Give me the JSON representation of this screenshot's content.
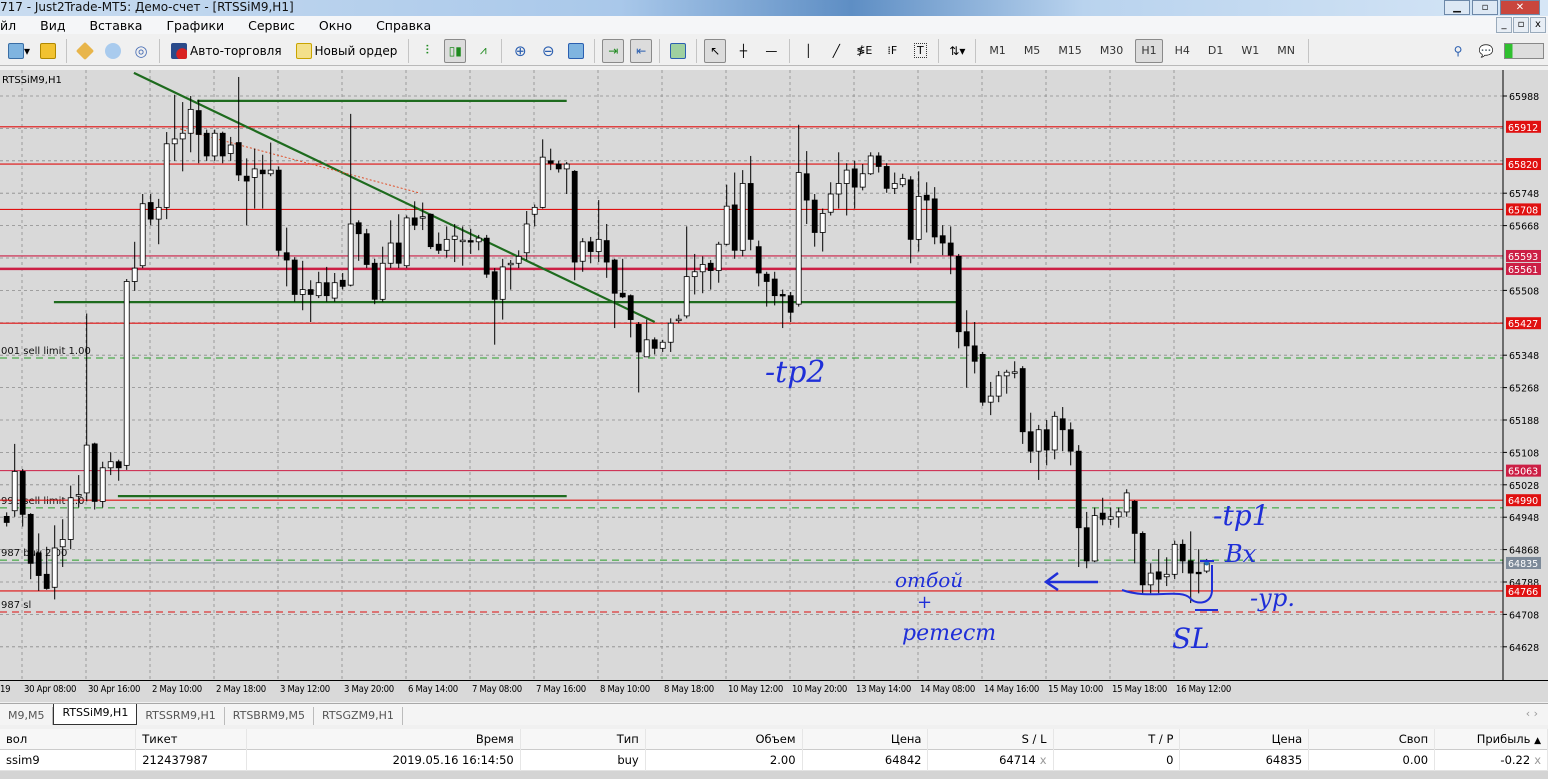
{
  "window": {
    "title": "717 - Just2Trade-MT5: Демо-счет - [RTSSiM9,H1]"
  },
  "menu": [
    "йл",
    "Вид",
    "Вставка",
    "Графики",
    "Сервис",
    "Окно",
    "Справка"
  ],
  "toolbar": {
    "auto_trading": "Авто-торговля",
    "new_order": "Новый ордер",
    "timeframes": [
      "M1",
      "M5",
      "M15",
      "M30",
      "H1",
      "H4",
      "D1",
      "W1",
      "MN"
    ],
    "active_timeframe": "H1"
  },
  "chart_data": {
    "type": "candlestick",
    "title": "RTSSiM9,H1",
    "ylim": [
      64560,
      66050
    ],
    "price_ticks": [
      "65988",
      "65748",
      "65668",
      "65508",
      "65348",
      "65268",
      "65188",
      "65108",
      "65028",
      "64948",
      "64868",
      "64788",
      "64708",
      "64628"
    ],
    "grid_prices": [
      65988,
      65908,
      65828,
      65748,
      65668,
      65588,
      65508,
      65428,
      65348,
      65268,
      65188,
      65108,
      65028,
      64948,
      64868,
      64788,
      64708,
      64628
    ],
    "time_labels": [
      "19",
      "30 Apr 08:00",
      "30 Apr 16:00",
      "2 May 10:00",
      "2 May 18:00",
      "3 May 12:00",
      "3 May 20:00",
      "6 May 14:00",
      "7 May 08:00",
      "7 May 16:00",
      "8 May 10:00",
      "8 May 18:00",
      "10 May 12:00",
      "10 May 20:00",
      "13 May 14:00",
      "14 May 08:00",
      "14 May 16:00",
      "15 May 10:00",
      "15 May 18:00",
      "16 May 12:00"
    ],
    "candles_ohlc": [
      [
        64950,
        64960,
        64925,
        64935
      ],
      [
        64964,
        65129,
        64949,
        65061
      ],
      [
        65061,
        65067,
        64925,
        64955
      ],
      [
        64955,
        64958,
        64795,
        64834
      ],
      [
        64860,
        64908,
        64766,
        64804
      ],
      [
        64807,
        64875,
        64769,
        64772
      ],
      [
        64775,
        64928,
        64745,
        64872
      ],
      [
        64875,
        64943,
        64825,
        64893
      ],
      [
        64893,
        65026,
        64869,
        64996
      ],
      [
        65000,
        65052,
        64972,
        65004
      ],
      [
        65008,
        65451,
        64987,
        65126
      ],
      [
        65129,
        65132,
        64967,
        64987
      ],
      [
        64987,
        65085,
        64972,
        65070
      ],
      [
        65070,
        65108,
        65052,
        65085
      ],
      [
        65085,
        65090,
        65038,
        65070
      ],
      [
        65076,
        65536,
        65065,
        65530
      ],
      [
        65530,
        65628,
        65507,
        65563
      ],
      [
        65569,
        65746,
        65563,
        65722
      ],
      [
        65725,
        65746,
        65669,
        65684
      ],
      [
        65684,
        65734,
        65622,
        65713
      ],
      [
        65713,
        65899,
        65684,
        65870
      ],
      [
        65870,
        65991,
        65828,
        65882
      ],
      [
        65882,
        65973,
        65802,
        65896
      ],
      [
        65896,
        65988,
        65849,
        65955
      ],
      [
        65952,
        65979,
        65822,
        65893
      ],
      [
        65896,
        65905,
        65828,
        65840
      ],
      [
        65840,
        65905,
        65828,
        65896
      ],
      [
        65896,
        65900,
        65822,
        65840
      ],
      [
        65846,
        65887,
        65828,
        65867
      ],
      [
        65873,
        66035,
        65778,
        65793
      ],
      [
        65790,
        65834,
        65669,
        65778
      ],
      [
        65787,
        65858,
        65710,
        65808
      ],
      [
        65805,
        65843,
        65710,
        65796
      ],
      [
        65796,
        65873,
        65790,
        65805
      ],
      [
        65805,
        65814,
        65592,
        65607
      ],
      [
        65601,
        65663,
        65518,
        65583
      ],
      [
        65583,
        65590,
        65480,
        65498
      ],
      [
        65498,
        65581,
        65459,
        65510
      ],
      [
        65510,
        65533,
        65430,
        65498
      ],
      [
        65495,
        65554,
        65489,
        65527
      ],
      [
        65527,
        65566,
        65480,
        65495
      ],
      [
        65489,
        65551,
        65480,
        65527
      ],
      [
        65533,
        65551,
        65510,
        65518
      ],
      [
        65521,
        65944,
        65518,
        65672
      ],
      [
        65675,
        65681,
        65581,
        65648
      ],
      [
        65648,
        65660,
        65563,
        65572
      ],
      [
        65575,
        65586,
        65474,
        65486
      ],
      [
        65486,
        65616,
        65480,
        65575
      ],
      [
        65575,
        65681,
        65563,
        65625
      ],
      [
        65625,
        65696,
        65563,
        65575
      ],
      [
        65569,
        65693,
        65563,
        65687
      ],
      [
        65687,
        65728,
        65657,
        65669
      ],
      [
        65688,
        65725,
        65657,
        65690
      ],
      [
        65696,
        65698,
        65610,
        65616
      ],
      [
        65622,
        65651,
        65598,
        65607
      ],
      [
        65607,
        65666,
        65589,
        65634
      ],
      [
        65634,
        65672,
        65578,
        65642
      ],
      [
        65630,
        65666,
        65569,
        65632
      ],
      [
        65631,
        65660,
        65598,
        65630
      ],
      [
        65628,
        65645,
        65607,
        65637
      ],
      [
        65637,
        65645,
        65539,
        65548
      ],
      [
        65554,
        65563,
        65374,
        65486
      ],
      [
        65486,
        65586,
        65436,
        65566
      ],
      [
        65572,
        65583,
        65510,
        65575
      ],
      [
        65575,
        65607,
        65563,
        65592
      ],
      [
        65601,
        65704,
        65583,
        65672
      ],
      [
        65696,
        65720,
        65666,
        65713
      ],
      [
        65713,
        65881,
        65710,
        65837
      ],
      [
        65828,
        65858,
        65805,
        65822
      ],
      [
        65820,
        65828,
        65799,
        65808
      ],
      [
        65808,
        65825,
        65746,
        65820
      ],
      [
        65802,
        65805,
        65533,
        65578
      ],
      [
        65580,
        65637,
        65554,
        65628
      ],
      [
        65628,
        65640,
        65575,
        65604
      ],
      [
        65604,
        65731,
        65578,
        65634
      ],
      [
        65631,
        65672,
        65539,
        65578
      ],
      [
        65583,
        65586,
        65415,
        65501
      ],
      [
        65501,
        65586,
        65489,
        65492
      ],
      [
        65495,
        65498,
        65392,
        65436
      ],
      [
        65424,
        65430,
        65256,
        65356
      ],
      [
        65344,
        65436,
        65344,
        65386
      ],
      [
        65386,
        65392,
        65350,
        65365
      ],
      [
        65365,
        65386,
        65356,
        65380
      ],
      [
        65380,
        65439,
        65356,
        65427
      ],
      [
        65434,
        65448,
        65427,
        65437
      ],
      [
        65445,
        65666,
        65439,
        65542
      ],
      [
        65542,
        65598,
        65498,
        65554
      ],
      [
        65554,
        65592,
        65501,
        65572
      ],
      [
        65575,
        65583,
        65510,
        65557
      ],
      [
        65557,
        65628,
        65527,
        65622
      ],
      [
        65622,
        65769,
        65619,
        65716
      ],
      [
        65719,
        65799,
        65586,
        65607
      ],
      [
        65607,
        65805,
        65592,
        65772
      ],
      [
        65772,
        65840,
        65607,
        65634
      ],
      [
        65616,
        65631,
        65518,
        65551
      ],
      [
        65548,
        65554,
        65468,
        65530
      ],
      [
        65536,
        65554,
        65471,
        65495
      ],
      [
        65498,
        65510,
        65415,
        65496
      ],
      [
        65495,
        65504,
        65430,
        65454
      ],
      [
        65474,
        65917,
        65468,
        65799
      ],
      [
        65796,
        65852,
        65672,
        65731
      ],
      [
        65731,
        65746,
        65616,
        65651
      ],
      [
        65651,
        65710,
        65604,
        65698
      ],
      [
        65701,
        65775,
        65693,
        65746
      ],
      [
        65746,
        65849,
        65710,
        65772
      ],
      [
        65772,
        65822,
        65693,
        65805
      ],
      [
        65808,
        65828,
        65710,
        65763
      ],
      [
        65763,
        65820,
        65755,
        65796
      ],
      [
        65796,
        65849,
        65793,
        65840
      ],
      [
        65840,
        65849,
        65799,
        65814
      ],
      [
        65814,
        65822,
        65749,
        65760
      ],
      [
        65760,
        65799,
        65746,
        65772
      ],
      [
        65769,
        65796,
        65763,
        65784
      ],
      [
        65781,
        65790,
        65575,
        65634
      ],
      [
        65634,
        65802,
        65604,
        65740
      ],
      [
        65743,
        65775,
        65651,
        65731
      ],
      [
        65734,
        65763,
        65622,
        65640
      ],
      [
        65643,
        65669,
        65595,
        65625
      ],
      [
        65625,
        65666,
        65548,
        65595
      ],
      [
        65592,
        65598,
        65365,
        65406
      ],
      [
        65406,
        65459,
        65268,
        65371
      ],
      [
        65371,
        65430,
        65303,
        65333
      ],
      [
        65350,
        65356,
        65223,
        65232
      ],
      [
        65232,
        65282,
        65200,
        65247
      ],
      [
        65247,
        65309,
        65232,
        65297
      ],
      [
        65297,
        65312,
        65253,
        65306
      ],
      [
        65305,
        65333,
        65291,
        65307
      ],
      [
        65315,
        65321,
        65129,
        65159
      ],
      [
        65159,
        65206,
        65082,
        65111
      ],
      [
        65111,
        65176,
        65040,
        65164
      ],
      [
        65164,
        65188,
        65076,
        65114
      ],
      [
        65114,
        65209,
        65091,
        65197
      ],
      [
        65191,
        65220,
        65111,
        65164
      ],
      [
        65164,
        65182,
        65076,
        65111
      ],
      [
        65111,
        65126,
        64825,
        64922
      ],
      [
        64922,
        64961,
        64822,
        64840
      ],
      [
        64840,
        64972,
        64837,
        64952
      ],
      [
        64958,
        64996,
        64928,
        64943
      ],
      [
        64943,
        64972,
        64928,
        64949
      ],
      [
        64949,
        64972,
        64922,
        64961
      ],
      [
        64961,
        65017,
        64949,
        65008
      ],
      [
        64987,
        64990,
        64834,
        64908
      ],
      [
        64908,
        64913,
        64760,
        64781
      ],
      [
        64781,
        64834,
        64760,
        64810
      ],
      [
        64813,
        64869,
        64760,
        64795
      ],
      [
        64801,
        64849,
        64778,
        64807
      ],
      [
        64807,
        64890,
        64795,
        64881
      ],
      [
        64881,
        64893,
        64810,
        64840
      ],
      [
        64840,
        64913,
        64736,
        64810
      ],
      [
        64812,
        64869,
        64760,
        64810
      ],
      [
        64815,
        64845,
        64810,
        64835
      ]
    ],
    "levels": [
      {
        "price": 65912,
        "label": "65912",
        "style": "solid",
        "color": "#e01010"
      },
      {
        "price": 65820,
        "label": "65820",
        "style": "solid",
        "color": "#e01010"
      },
      {
        "price": 65708,
        "label": "65708",
        "style": "solid",
        "color": "#e01010"
      },
      {
        "price": 65593,
        "label": "65593",
        "style": "solid",
        "color": "#cc1f45"
      },
      {
        "price": 65561,
        "label": "65561",
        "style": "thick",
        "color": "#cc1f45"
      },
      {
        "price": 65427,
        "label": "65427",
        "style": "solid",
        "color": "#e01010"
      },
      {
        "price": 65063,
        "label": "65063",
        "style": "solid",
        "color": "#cc1f45"
      },
      {
        "price": 64990,
        "label": "64990",
        "style": "solid",
        "color": "#e01010"
      },
      {
        "price": 64835,
        "label": "64835",
        "style": "bid",
        "color": "#7d8a99"
      },
      {
        "price": 64766,
        "label": "64766",
        "style": "solid",
        "color": "#e01010"
      }
    ],
    "orders": [
      {
        "price": 65341,
        "label": "001 sell limit 1.00",
        "color": "#2aa02a",
        "style": "dash"
      },
      {
        "price": 64971,
        "label": "991 sell limit 1.0",
        "color": "#2aa02a",
        "style": "dash"
      },
      {
        "price": 64842,
        "label": "987 buy 2.00",
        "color": "#2aa02a",
        "style": "dash"
      },
      {
        "price": 64714,
        "label": "987 sl",
        "color": "#e01010",
        "style": "dash"
      }
    ],
    "trendlines": [
      {
        "from": [
          15.9,
          66045
        ],
        "to": [
          81,
          65430
        ],
        "color": "#1e6b1e"
      },
      {
        "from": [
          23.8,
          65976
        ],
        "to": [
          70,
          65976
        ],
        "color": "#1e6b1e"
      },
      {
        "from": [
          5.9,
          65479
        ],
        "to": [
          118.8,
          65479
        ],
        "color": "#1e6b1e"
      },
      {
        "from": [
          13.9,
          65000
        ],
        "to": [
          70,
          65000
        ],
        "color": "#1e6b1e"
      }
    ],
    "history_line": {
      "from": [
        21.7,
        65906
      ],
      "to": [
        51.7,
        65748
      ],
      "color": "#e0502a"
    },
    "annotations": {
      "tp2": "-tp2",
      "tp1": "-tp1",
      "entry": "Bx",
      "level": "-ур.",
      "bounce": "отбой",
      "plus": "+",
      "retest": "ретест",
      "sl": "SL"
    }
  },
  "tabs": [
    "M9,M5",
    "RTSSiM9,H1",
    "RTSSRM9,H1",
    "RTSBRM9,M5",
    "RTSGZM9,H1"
  ],
  "active_tab": 1,
  "positions": {
    "headers": [
      "вол",
      "Тикет",
      "Время",
      "Тип",
      "Объем",
      "Цена",
      "S / L",
      "T / P",
      "Цена",
      "Своп",
      "Прибыль"
    ],
    "rows": [
      [
        "ssim9",
        "212437987",
        "2019.05.16 16:14:50",
        "buy",
        "2.00",
        "64842",
        "64714",
        "0",
        "64835",
        "0.00",
        "-0.22"
      ]
    ]
  },
  "colors": {
    "bg": "#d9d9d9",
    "grid": "#8c8c8c",
    "annotation": "#1f2fd8"
  }
}
